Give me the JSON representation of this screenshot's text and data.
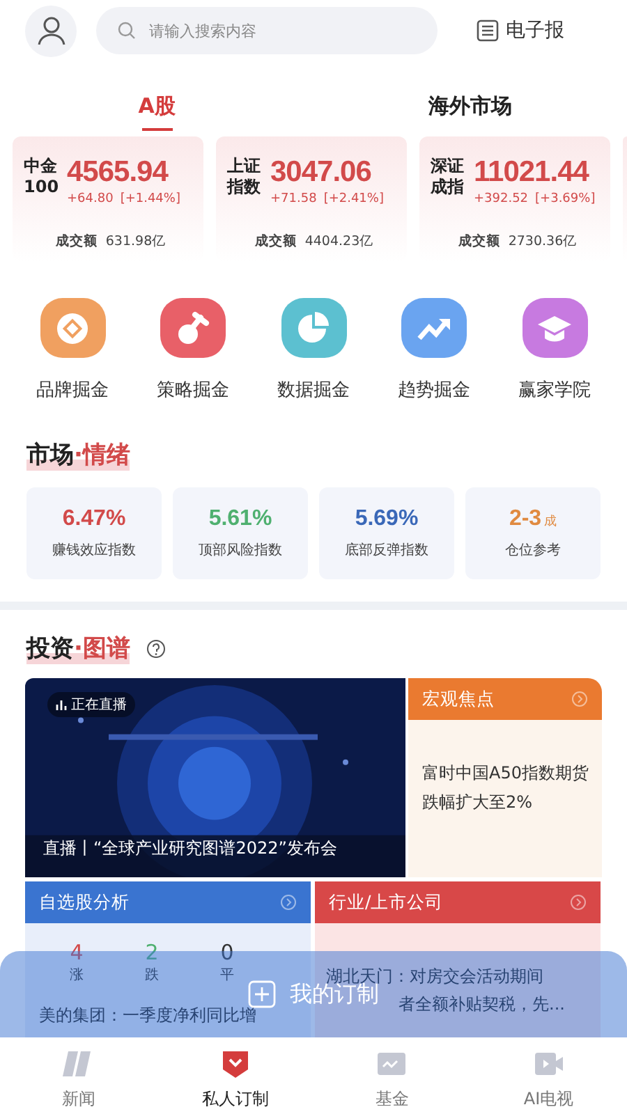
{
  "header": {
    "search_placeholder": "请输入搜索内容",
    "epaper": "电子报"
  },
  "market_tabs": [
    {
      "label": "A股",
      "selected": true
    },
    {
      "label": "海外市场",
      "selected": false
    }
  ],
  "indices": [
    {
      "name": "中金100",
      "value": "4565.94",
      "change": "+64.80",
      "percent": "[+1.44%]",
      "turnover_label": "成交额",
      "turnover": "631.98亿"
    },
    {
      "name": "上证指数",
      "value": "3047.06",
      "change": "+71.58",
      "percent": "[+2.41%]",
      "turnover_label": "成交额",
      "turnover": "4404.23亿"
    },
    {
      "name": "深证成指",
      "value": "11021.44",
      "change": "+392.52",
      "percent": "[+3.69%]",
      "turnover_label": "成交额",
      "turnover": "2730.36亿"
    }
  ],
  "shortcuts": [
    {
      "label": "品牌掘金",
      "color": "#f0a060",
      "kind": "coin"
    },
    {
      "label": "策略掘金",
      "color": "#e86068",
      "kind": "pin"
    },
    {
      "label": "数据掘金",
      "color": "#5cc0d0",
      "kind": "pie"
    },
    {
      "label": "趋势掘金",
      "color": "#6aa4f0",
      "kind": "trend"
    },
    {
      "label": "赢家学院",
      "color": "#c77ae0",
      "kind": "cap"
    }
  ],
  "sentiment": {
    "title": "市场",
    "separator": "·",
    "title_accent": "情绪",
    "items": [
      {
        "value": "6.47%",
        "label": "赚钱效应指数",
        "color": "#d24a4a"
      },
      {
        "value": "5.61%",
        "label": "顶部风险指数",
        "color": "#4fb070"
      },
      {
        "value": "5.69%",
        "label": "底部反弹指数",
        "color": "#3a68b8"
      },
      {
        "value": "2-3",
        "unit": "成",
        "label": "仓位参考",
        "color": "#e08a40"
      }
    ]
  },
  "atlas": {
    "title": "投资",
    "separator": "·",
    "title_accent": "图谱",
    "live": {
      "badge": "正在直播",
      "caption": "直播丨“全球产业研究图谱2022”发布会"
    },
    "macro": {
      "title": "宏观焦点",
      "color": "#ea7a30",
      "text": "富时中国A50指数期货跌幅扩大至2%"
    },
    "watchlist": {
      "title": "自选股分析",
      "color": "#3a74d0",
      "stats": [
        {
          "count": "4",
          "label": "涨",
          "color": "#d24a4a"
        },
        {
          "count": "2",
          "label": "跌",
          "color": "#4fb070"
        },
        {
          "count": "0",
          "label": "平",
          "color": "#333333"
        }
      ],
      "news": "美的集团：一季度净利同比增"
    },
    "industry": {
      "title": "行业/上市公司",
      "color": "#d84848",
      "news_line_1": "湖北天门：对房交会活动期间",
      "news_line_2": "者全额补贴契税，先..."
    }
  },
  "subscribe_button": "我的订制",
  "nav": [
    {
      "label": "新闻",
      "selected": false,
      "kind": "news"
    },
    {
      "label": "私人订制",
      "selected": true,
      "kind": "custom"
    },
    {
      "label": "基金",
      "selected": false,
      "kind": "fund"
    },
    {
      "label": "AI电视",
      "selected": false,
      "kind": "tv"
    }
  ]
}
